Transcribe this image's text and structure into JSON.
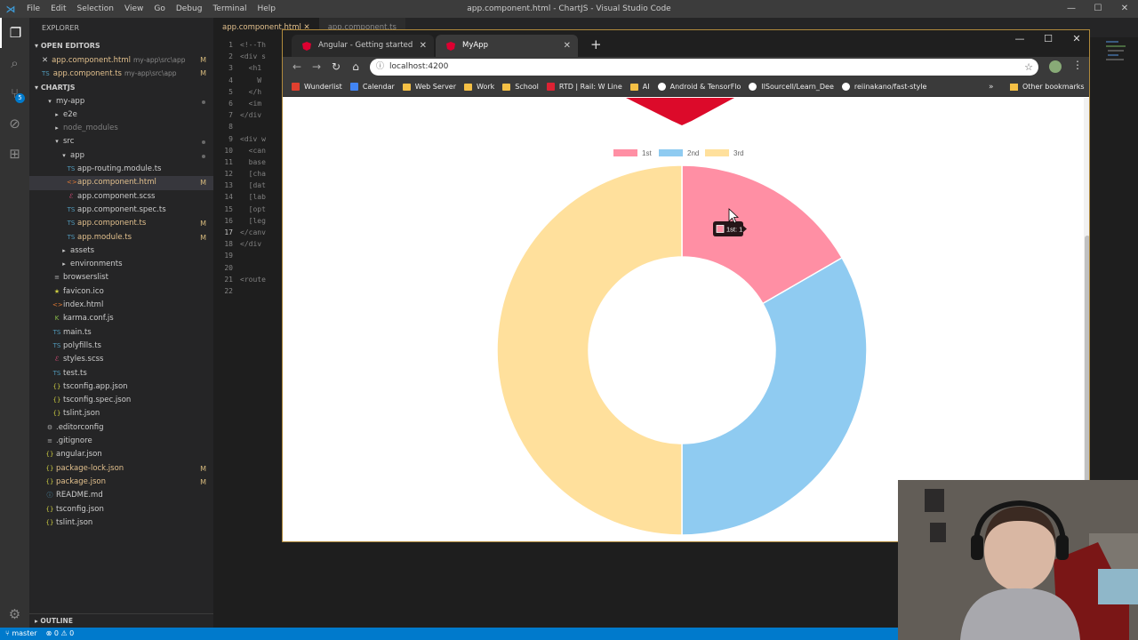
{
  "vscode": {
    "title": "app.component.html - ChartJS - Visual Studio Code",
    "menu": [
      "File",
      "Edit",
      "Selection",
      "View",
      "Go",
      "Debug",
      "Terminal",
      "Help"
    ],
    "explorer_label": "EXPLORER",
    "open_editors_label": "OPEN EDITORS",
    "open_editors": [
      {
        "name": "app.component.html",
        "path": "my-app\\src\\app",
        "status": "M"
      },
      {
        "name": "app.component.ts",
        "path": "my-app\\src\\app",
        "status": "M"
      }
    ],
    "project_label": "CHARTJS",
    "tree": [
      {
        "name": "my-app",
        "kind": "folder-open"
      },
      {
        "name": "e2e",
        "kind": "folder"
      },
      {
        "name": "node_modules",
        "kind": "folder"
      },
      {
        "name": "src",
        "kind": "folder-open"
      },
      {
        "name": "app",
        "kind": "folder-open"
      },
      {
        "name": "app-routing.module.ts",
        "kind": "ts"
      },
      {
        "name": "app.component.html",
        "kind": "html",
        "status": "M"
      },
      {
        "name": "app.component.scss",
        "kind": "scss"
      },
      {
        "name": "app.component.spec.ts",
        "kind": "ts"
      },
      {
        "name": "app.component.ts",
        "kind": "ts",
        "status": "M"
      },
      {
        "name": "app.module.ts",
        "kind": "ts",
        "status": "M"
      },
      {
        "name": "assets",
        "kind": "folder"
      },
      {
        "name": "environments",
        "kind": "folder"
      },
      {
        "name": "browserslist",
        "kind": "file"
      },
      {
        "name": "favicon.ico",
        "kind": "ico"
      },
      {
        "name": "index.html",
        "kind": "html"
      },
      {
        "name": "karma.conf.js",
        "kind": "js"
      },
      {
        "name": "main.ts",
        "kind": "ts"
      },
      {
        "name": "polyfills.ts",
        "kind": "ts"
      },
      {
        "name": "styles.scss",
        "kind": "scss"
      },
      {
        "name": "test.ts",
        "kind": "ts"
      },
      {
        "name": "tsconfig.app.json",
        "kind": "json"
      },
      {
        "name": "tsconfig.spec.json",
        "kind": "json"
      },
      {
        "name": "tslint.json",
        "kind": "json"
      },
      {
        "name": ".editorconfig",
        "kind": "config"
      },
      {
        "name": ".gitignore",
        "kind": "file"
      },
      {
        "name": "angular.json",
        "kind": "json"
      },
      {
        "name": "package-lock.json",
        "kind": "json",
        "status": "M"
      },
      {
        "name": "package.json",
        "kind": "json",
        "status": "M"
      },
      {
        "name": "README.md",
        "kind": "md"
      },
      {
        "name": "tsconfig.json",
        "kind": "json"
      },
      {
        "name": "tslint.json",
        "kind": "json"
      }
    ],
    "outline_label": "OUTLINE",
    "tabs": [
      "app.component.html",
      "app.component.ts"
    ],
    "line_numbers": [
      "1",
      "2",
      "3",
      "4",
      "5",
      "6",
      "7",
      "8",
      "9",
      "10",
      "11",
      "12",
      "13",
      "14",
      "15",
      "16",
      "17",
      "18",
      "19",
      "20",
      "21",
      "22"
    ],
    "code_fragments": [
      "<!--Th",
      "<div s",
      "  <h1",
      "    W",
      "  </h",
      "  <im",
      "</div",
      "",
      "<div w",
      "  <can",
      "  base",
      "  [cha",
      "  [dat",
      "  [lab",
      "  [opt",
      "  [leg",
      "</canv",
      "</div",
      "",
      "",
      "<route",
      ""
    ],
    "status": {
      "branch": "master",
      "errors": "0",
      "warnings": "0"
    }
  },
  "browser": {
    "tabs": [
      {
        "label": "Angular - Getting started",
        "active": false
      },
      {
        "label": "MyApp",
        "active": true
      }
    ],
    "url": "localhost:4200",
    "bookmarks": [
      "Wunderlist",
      "Calendar",
      "Web Server",
      "Work",
      "School",
      "RTD | Rail: W Line",
      "AI",
      "Android & TensorFlo",
      "llSourcell/Learn_Dee",
      "reiinakano/fast-style"
    ],
    "other_bookmarks": "Other bookmarks"
  },
  "chart_data": {
    "type": "doughnut",
    "categories": [
      "1st",
      "2nd",
      "3rd"
    ],
    "values": [
      1,
      2,
      3
    ],
    "colors": [
      "#ff8fa4",
      "#8fcbf1",
      "#ffe09c"
    ],
    "legend_position": "top",
    "tooltip": "1st: 1"
  }
}
